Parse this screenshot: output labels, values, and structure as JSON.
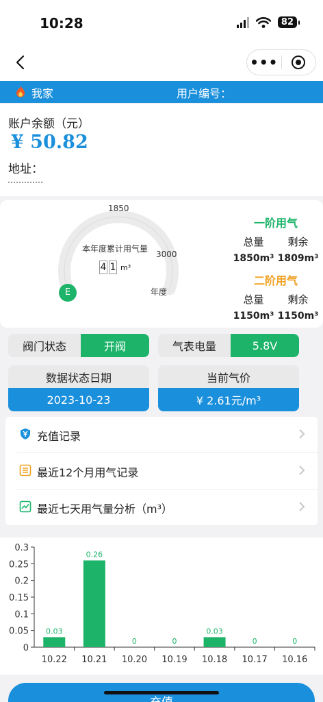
{
  "status_bar": {
    "time": "10:28",
    "battery": "82"
  },
  "header": {
    "home_name": "我家",
    "user_no_label": "用户编号："
  },
  "account": {
    "balance_label": "账户余额（元）",
    "balance": "¥ 50.82",
    "address_label": "地址："
  },
  "gauge": {
    "title": "本年度累计用气量",
    "digits": [
      "4",
      "1"
    ],
    "unit": "m³",
    "tick_mid": "1850",
    "tick_max": "3000",
    "year_label": "年度",
    "empty_label": "E"
  },
  "tiers": [
    {
      "title": "一阶用气",
      "total_label": "总量",
      "remain_label": "剩余",
      "total": "1850m³",
      "remain": "1809m³",
      "color": "#1db469"
    },
    {
      "title": "二阶用气",
      "total_label": "总量",
      "remain_label": "剩余",
      "total": "1150m³",
      "remain": "1150m³",
      "color": "#f0a020"
    }
  ],
  "valve": {
    "label": "阀门状态",
    "value": "开阀"
  },
  "meter_power": {
    "label": "气表电量",
    "value": "5.8V"
  },
  "data_date": {
    "label": "数据状态日期",
    "value": "2023-10-23"
  },
  "gas_price": {
    "label": "当前气价",
    "value": "¥ 2.61元/m³"
  },
  "menu": [
    {
      "label": "充值记录",
      "icon": "shield-yen-icon"
    },
    {
      "label": "最近12个月用气记录",
      "icon": "list-icon"
    },
    {
      "label": "最近七天用气量分析（m³）",
      "icon": "line-chart-icon"
    }
  ],
  "chart_data": {
    "type": "bar",
    "categories": [
      "10.22",
      "10.21",
      "10.20",
      "10.19",
      "10.18",
      "10.17",
      "10.16"
    ],
    "values": [
      0.03,
      0.26,
      0,
      0,
      0.03,
      0,
      0
    ],
    "ylim": [
      0,
      0.3
    ],
    "yticks": [
      "0",
      "0.05",
      "0.1",
      "0.15",
      "0.2",
      "0.25",
      "0.3"
    ],
    "bar_color": "#1db469",
    "grid": false
  },
  "footer": {
    "recharge_label": "充值"
  },
  "colors": {
    "primary": "#1a8fdc",
    "green": "#1db469",
    "orange": "#f0a020"
  }
}
